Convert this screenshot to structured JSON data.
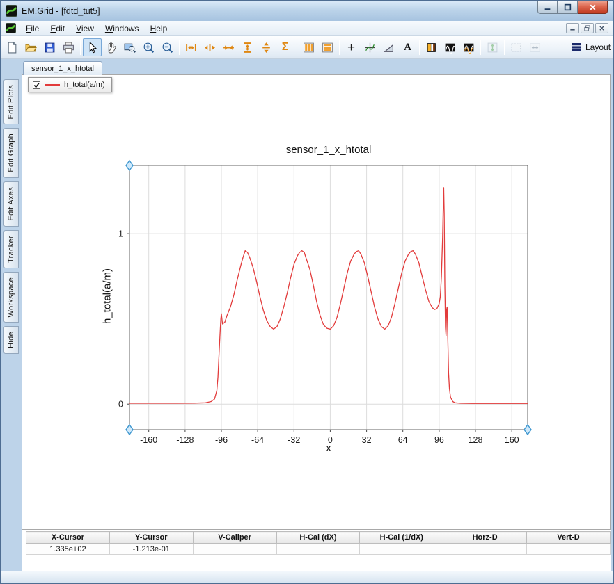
{
  "window": {
    "title": "EM.Grid - [fdtd_tut5]"
  },
  "menu": {
    "items": [
      {
        "label": "File"
      },
      {
        "label": "Edit"
      },
      {
        "label": "View"
      },
      {
        "label": "Windows"
      },
      {
        "label": "Help"
      }
    ]
  },
  "toolbar": {
    "layout_label": "Layout",
    "glyphs": {
      "sum": "Σ",
      "plus": "+",
      "text": "A"
    }
  },
  "tabs": {
    "active": "sensor_1_x_htotal"
  },
  "legend": {
    "label": "h_total(a/m)",
    "checked": true
  },
  "side_tabs": {
    "items": [
      "Edit Plots",
      "Edit Graph",
      "Edit Axes",
      "Tracker",
      "Workspace",
      "Hide"
    ]
  },
  "chart_data": {
    "type": "line",
    "title": "sensor_1_x_htotal",
    "xlabel": "x",
    "ylabel": "h_total(a/m)",
    "xlim": [
      -177,
      174
    ],
    "ylim": [
      -0.15,
      1.4
    ],
    "xticks": [
      -160,
      -128,
      -96,
      -64,
      -32,
      0,
      32,
      64,
      96,
      128,
      160
    ],
    "yticks": [
      0,
      1
    ],
    "grid": true,
    "legend_position": "top-left-overlay",
    "series": [
      {
        "name": "h_total(a/m)",
        "color": "#e23b3b",
        "points": [
          [
            -177,
            0.005
          ],
          [
            -160,
            0.005
          ],
          [
            -140,
            0.005
          ],
          [
            -120,
            0.006
          ],
          [
            -110,
            0.008
          ],
          [
            -105,
            0.015
          ],
          [
            -102,
            0.03
          ],
          [
            -100,
            0.08
          ],
          [
            -99,
            0.16
          ],
          [
            -98,
            0.3
          ],
          [
            -97,
            0.44
          ],
          [
            -96.5,
            0.5
          ],
          [
            -96,
            0.53
          ],
          [
            -95,
            0.47
          ],
          [
            -93,
            0.48
          ],
          [
            -91,
            0.52
          ],
          [
            -88,
            0.57
          ],
          [
            -85,
            0.64
          ],
          [
            -82,
            0.73
          ],
          [
            -79,
            0.81
          ],
          [
            -77,
            0.86
          ],
          [
            -75,
            0.9
          ],
          [
            -73,
            0.89
          ],
          [
            -71,
            0.86
          ],
          [
            -68,
            0.8
          ],
          [
            -65,
            0.72
          ],
          [
            -62,
            0.63
          ],
          [
            -59,
            0.55
          ],
          [
            -56,
            0.49
          ],
          [
            -53,
            0.455
          ],
          [
            -50,
            0.44
          ],
          [
            -47,
            0.455
          ],
          [
            -44,
            0.5
          ],
          [
            -41,
            0.57
          ],
          [
            -38,
            0.65
          ],
          [
            -35,
            0.74
          ],
          [
            -32,
            0.82
          ],
          [
            -29,
            0.87
          ],
          [
            -27,
            0.89
          ],
          [
            -25,
            0.9
          ],
          [
            -23,
            0.89
          ],
          [
            -21,
            0.85
          ],
          [
            -18,
            0.79
          ],
          [
            -15,
            0.7
          ],
          [
            -12,
            0.6
          ],
          [
            -9,
            0.52
          ],
          [
            -6,
            0.465
          ],
          [
            -3,
            0.445
          ],
          [
            0,
            0.44
          ],
          [
            3,
            0.46
          ],
          [
            6,
            0.51
          ],
          [
            9,
            0.59
          ],
          [
            12,
            0.68
          ],
          [
            15,
            0.77
          ],
          [
            18,
            0.84
          ],
          [
            21,
            0.88
          ],
          [
            23,
            0.895
          ],
          [
            25,
            0.9
          ],
          [
            27,
            0.88
          ],
          [
            30,
            0.83
          ],
          [
            33,
            0.75
          ],
          [
            36,
            0.66
          ],
          [
            39,
            0.57
          ],
          [
            42,
            0.5
          ],
          [
            45,
            0.455
          ],
          [
            48,
            0.44
          ],
          [
            51,
            0.46
          ],
          [
            54,
            0.51
          ],
          [
            57,
            0.59
          ],
          [
            60,
            0.68
          ],
          [
            63,
            0.77
          ],
          [
            66,
            0.84
          ],
          [
            69,
            0.88
          ],
          [
            71,
            0.895
          ],
          [
            73,
            0.9
          ],
          [
            75,
            0.88
          ],
          [
            78,
            0.83
          ],
          [
            81,
            0.75
          ],
          [
            84,
            0.67
          ],
          [
            87,
            0.6
          ],
          [
            90,
            0.565
          ],
          [
            92,
            0.555
          ],
          [
            94,
            0.56
          ],
          [
            96,
            0.59
          ],
          [
            97,
            0.63
          ],
          [
            98,
            0.75
          ],
          [
            99,
            0.98
          ],
          [
            99.6,
            1.18
          ],
          [
            100,
            1.27
          ],
          [
            100.4,
            1.12
          ],
          [
            101,
            0.7
          ],
          [
            101.5,
            0.45
          ],
          [
            102,
            0.4
          ],
          [
            102.5,
            0.55
          ],
          [
            103,
            0.57
          ],
          [
            103.6,
            0.38
          ],
          [
            104.3,
            0.18
          ],
          [
            105,
            0.09
          ],
          [
            106,
            0.04
          ],
          [
            108,
            0.015
          ],
          [
            110,
            0.008
          ],
          [
            115,
            0.005
          ],
          [
            125,
            0.004
          ],
          [
            140,
            0.004
          ],
          [
            160,
            0.004
          ],
          [
            174,
            0.004
          ]
        ]
      }
    ]
  },
  "table": {
    "headers": [
      "X-Cursor",
      "Y-Cursor",
      "V-Caliper",
      "H-Cal (dX)",
      "H-Cal (1/dX)",
      "Horz-D",
      "Vert-D"
    ],
    "values": [
      "1.335e+02",
      "-1.213e-01",
      "",
      "",
      "",
      "",
      ""
    ]
  }
}
